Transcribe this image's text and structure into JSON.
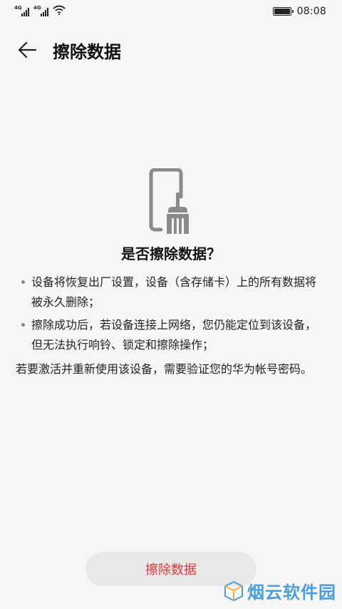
{
  "status_bar": {
    "network_1": "4G",
    "network_2": "4G",
    "time": "08:08",
    "battery_level": 1.0
  },
  "header": {
    "title": "擦除数据"
  },
  "main": {
    "question": "是否擦除数据？",
    "bullets": [
      "设备将恢复出厂设置，设备（含存储卡）上的所有数据将被永久删除；",
      "擦除成功后，若设备连接上网络，您仍能定位到该设备，但无法执行响铃、锁定和擦除操作；"
    ],
    "note": "若要激活并重新使用该设备，需要验证您的华为帐号密码。",
    "erase_button_label": "擦除数据"
  },
  "watermark": {
    "text": "烟云软件园"
  },
  "colors": {
    "danger": "#e8323c",
    "background": "#f6f6f6",
    "button_bg": "#e8e8e8",
    "watermark": "#4a9ee0",
    "icon_gray": "#8a8a8a"
  },
  "icons": [
    "back-arrow-icon",
    "phone-broom-icon",
    "wifi-icon",
    "battery-icon",
    "signal-icon"
  ]
}
